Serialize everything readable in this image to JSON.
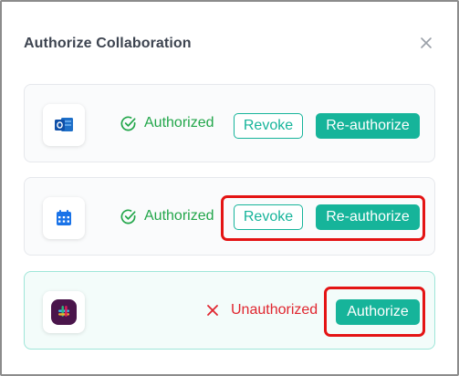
{
  "dialog": {
    "title": "Authorize Collaboration",
    "close_icon": "close-icon"
  },
  "integrations": [
    {
      "app_icon": "outlook-icon",
      "status_icon": "check-circle-icon",
      "status": "Authorized",
      "revoke_label": "Revoke",
      "reauthorize_label": "Re-authorize"
    },
    {
      "app_icon": "calendar-icon",
      "status_icon": "check-circle-icon",
      "status": "Authorized",
      "revoke_label": "Revoke",
      "reauthorize_label": "Re-authorize"
    },
    {
      "app_icon": "slack-icon",
      "status_icon": "x-icon",
      "status": "Unauthorized",
      "authorize_label": "Authorize"
    }
  ],
  "colors": {
    "accent": "#16b49a",
    "authorized": "#22a64a",
    "unauthorized": "#e0262f",
    "highlight": "#e41414"
  }
}
